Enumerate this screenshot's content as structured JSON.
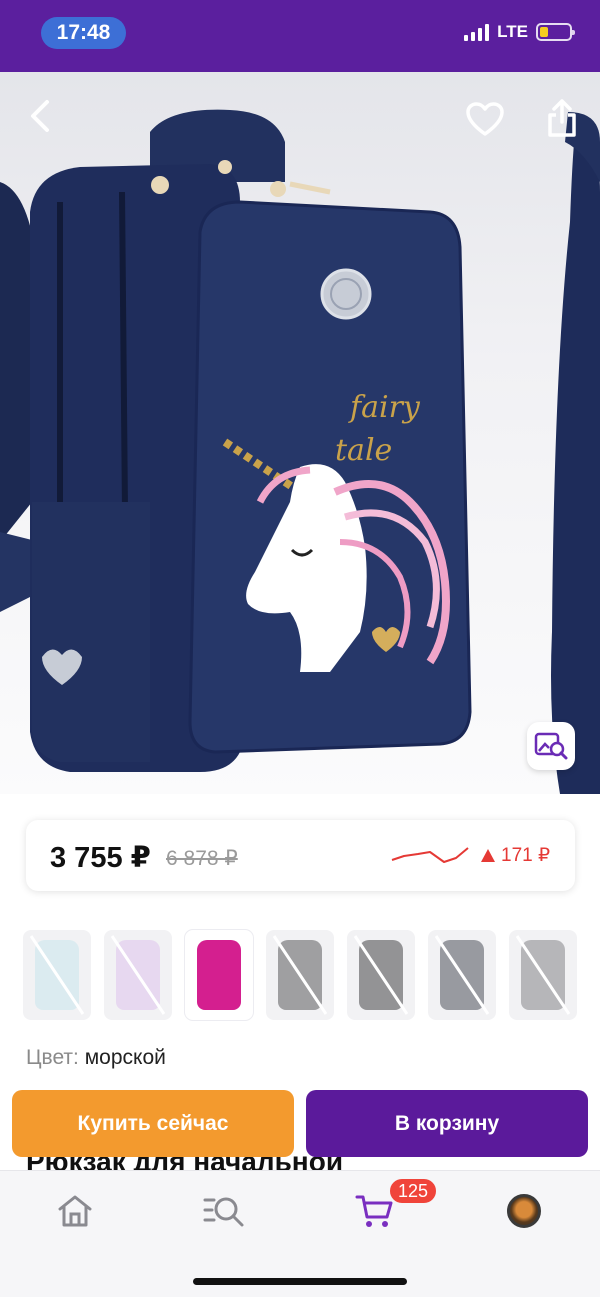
{
  "status_bar": {
    "time": "17:48",
    "network": "LTE"
  },
  "product": {
    "image_alt": "",
    "title_peek": "Рюкзак для начальной"
  },
  "price": {
    "current": "3 755 ₽",
    "old": "6 878 ₽",
    "change": "171 ₽",
    "change_direction": "up",
    "change_color": "#e53935"
  },
  "variants": [
    {
      "color": "#bfe3ea",
      "available": true,
      "crossed": true
    },
    {
      "color": "#d9b8ea",
      "available": true,
      "crossed": true
    },
    {
      "color": "#d41f8f",
      "available": true,
      "crossed": false
    },
    {
      "color": "#3a3a3c",
      "available": false,
      "crossed": true
    },
    {
      "color": "#1f1f22",
      "available": false,
      "crossed": true
    },
    {
      "color": "#2a2f3a",
      "available": false,
      "crossed": true
    },
    {
      "color": "#6d6d72",
      "available": false,
      "crossed": true
    }
  ],
  "color": {
    "label": "Цвет:",
    "value": "морской"
  },
  "actions": {
    "buy_now": "Купить сейчас",
    "add_to_cart": "В корзину"
  },
  "nav": {
    "cart_count": "125",
    "items": [
      "home-icon",
      "catalog-search-icon",
      "cart-icon",
      "profile-avatar"
    ]
  },
  "colors": {
    "brand": "#5b1f9e",
    "buy_now": "#f39a2e",
    "to_cart": "#5b1a9b",
    "badge": "#f0443a"
  }
}
